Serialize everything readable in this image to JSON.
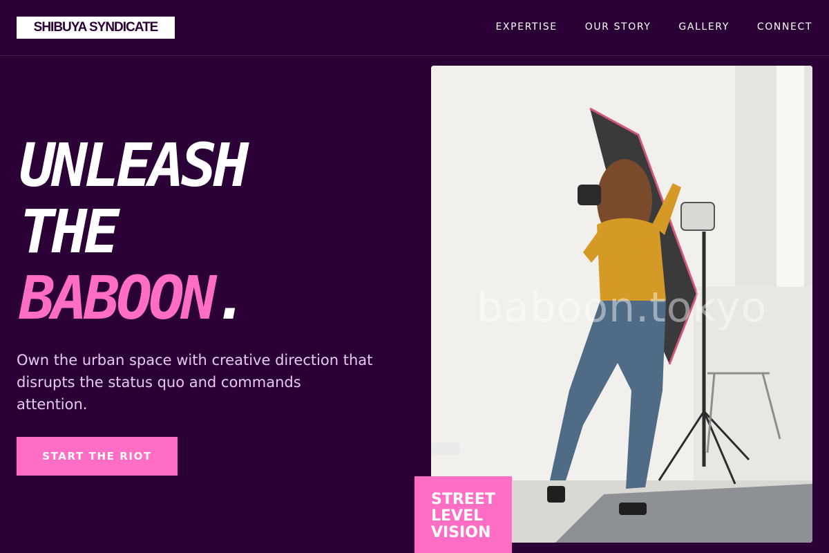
{
  "brand": {
    "name": "SHIBUYA SYNDICATE"
  },
  "nav": {
    "items": [
      {
        "label": "EXPERTISE"
      },
      {
        "label": "OUR STORY"
      },
      {
        "label": "GALLERY"
      },
      {
        "label": "CONNECT"
      }
    ]
  },
  "hero": {
    "headline": {
      "line1": "UNLEASH",
      "line2": "THE",
      "accent": "BABOON",
      "period": "."
    },
    "subtitle": "Own the urban space with creative direction that disrupts the status quo and commands attention.",
    "cta_label": "START THE RIOT"
  },
  "photo": {
    "watermark": "baboon.tokyo",
    "badge": {
      "line1": "STREET",
      "line2": "LEVEL",
      "line3": "VISION"
    }
  },
  "colors": {
    "background": "#2b0036",
    "accent": "#ff6ec4",
    "text": "#ffffff",
    "subtext": "#e7c9ef"
  }
}
